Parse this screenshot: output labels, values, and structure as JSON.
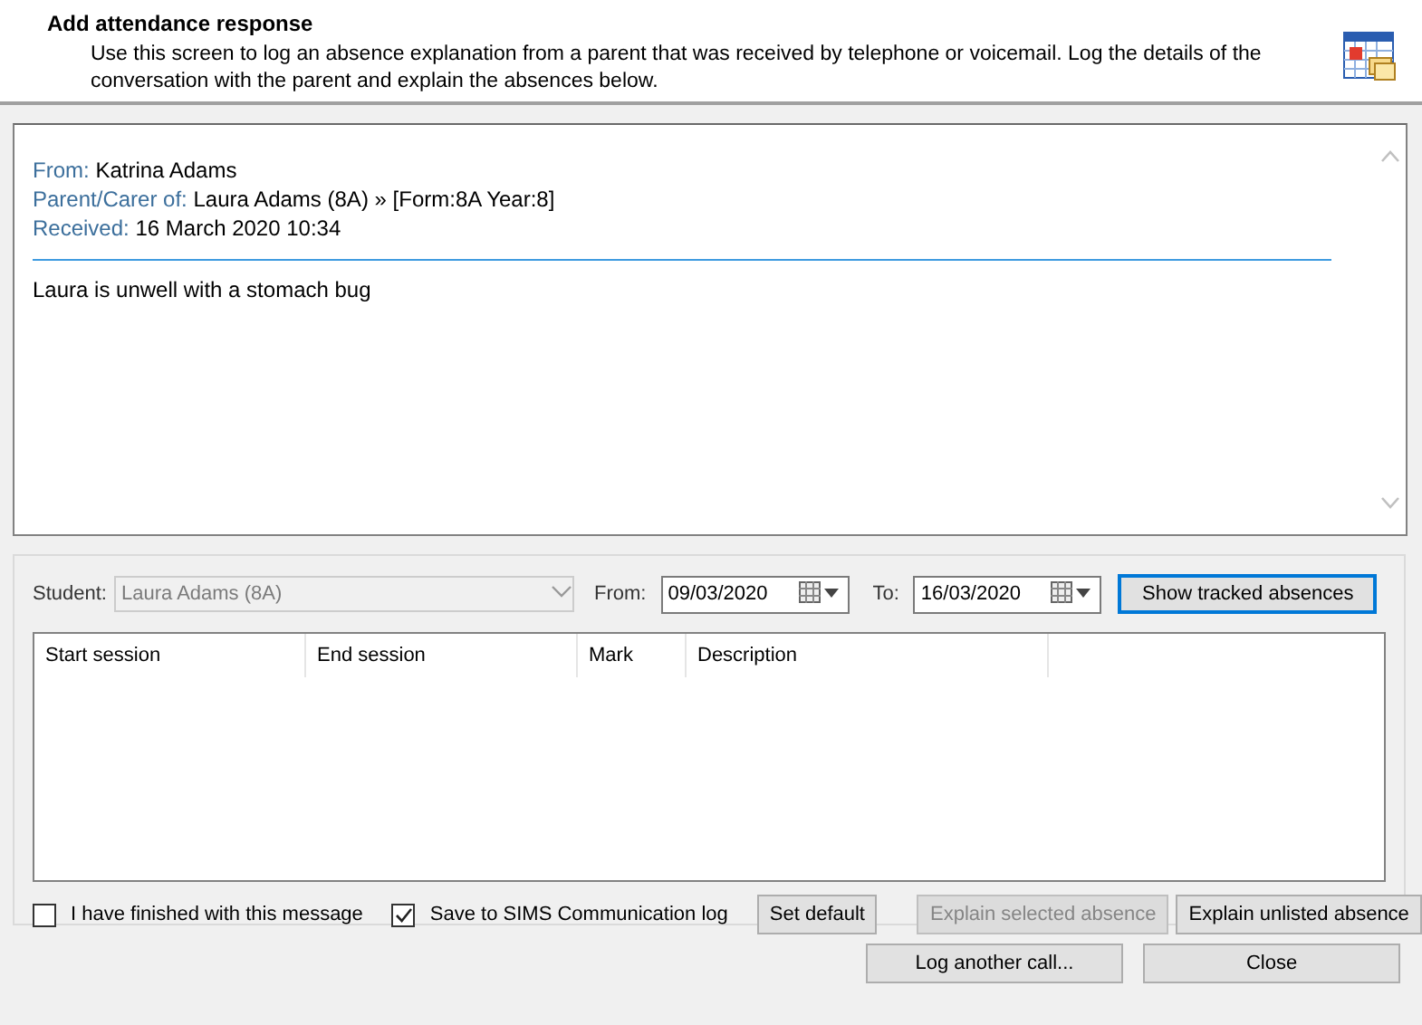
{
  "header": {
    "title": "Add attendance response",
    "description": "Use this screen to log an absence explanation from a parent that was received by telephone or voicemail. Log the details of the conversation with the parent and explain the absences below."
  },
  "message": {
    "from_label": "From:",
    "from": "Katrina Adams",
    "parent_label": "Parent/Carer of:",
    "parent": "Laura Adams (8A) » [Form:8A Year:8]",
    "received_label": "Received:",
    "received": "16 March 2020 10:34",
    "body": "Laura is unwell with a stomach bug"
  },
  "filters": {
    "student_label": "Student:",
    "student": {
      "value": "Laura Adams (8A)",
      "disabled": true
    },
    "from_label": "From:",
    "from": "09/03/2020",
    "to_label": "To:",
    "to": "16/03/2020",
    "button": {
      "label": "Show tracked absences",
      "focused": true
    }
  },
  "table": {
    "columns": [
      "Start session",
      "End session",
      "Mark",
      "Description"
    ]
  },
  "options": [
    {
      "label": "I have finished with this message",
      "checked": false
    },
    {
      "label": "Save to SIMS Communication log",
      "checked": true
    }
  ],
  "panel_buttons": [
    {
      "label": "Set default",
      "disabled": false
    },
    {
      "label": "Explain selected absence",
      "disabled": true
    },
    {
      "label": "Explain unlisted absence",
      "disabled": false
    }
  ],
  "footer_buttons": [
    {
      "label": "Log another call...",
      "disabled": false
    },
    {
      "label": "Close",
      "disabled": false
    }
  ]
}
